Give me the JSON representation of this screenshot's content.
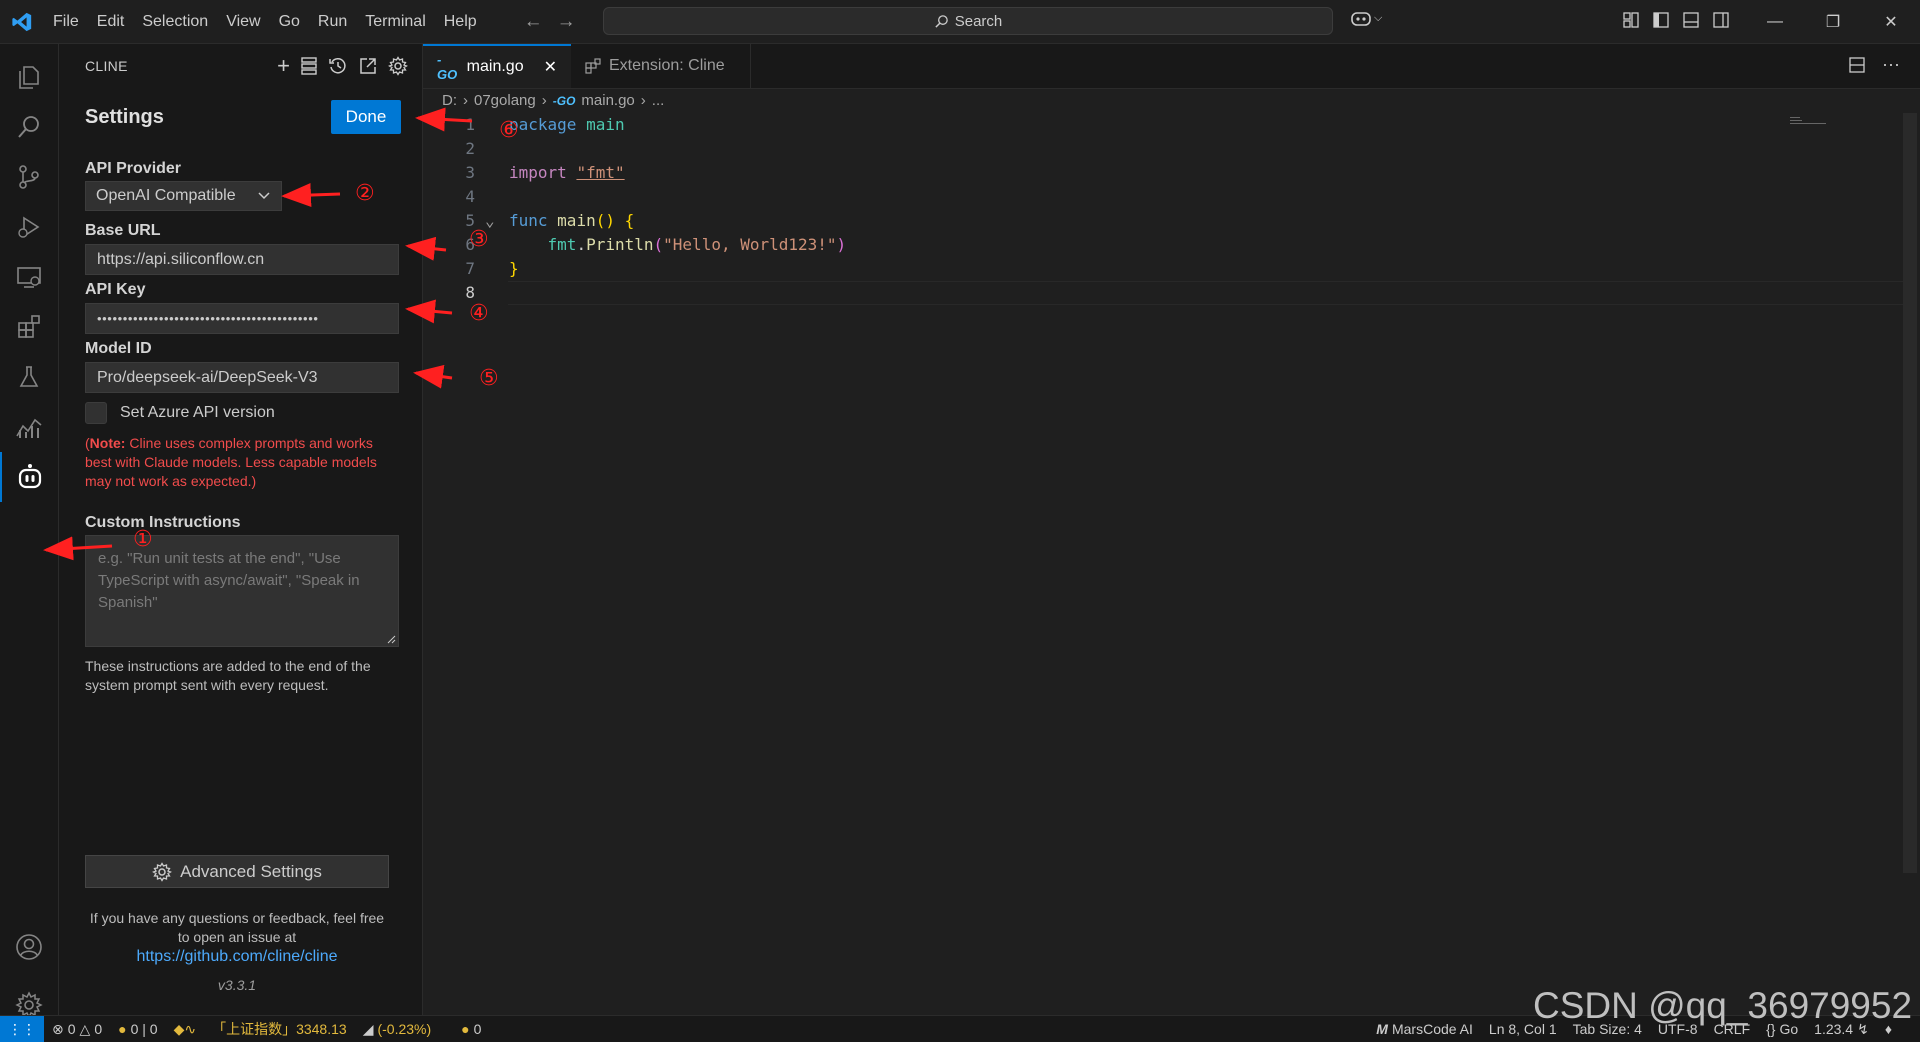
{
  "menu": [
    "File",
    "Edit",
    "Selection",
    "View",
    "Go",
    "Run",
    "Terminal",
    "Help"
  ],
  "search": {
    "label": "Search"
  },
  "sidebar": {
    "title": "CLINE",
    "settings_title": "Settings",
    "done_label": "Done",
    "api_provider_label": "API Provider",
    "api_provider_value": "OpenAI Compatible",
    "base_url_label": "Base URL",
    "base_url_value": "https://api.siliconflow.cn",
    "api_key_label": "API Key",
    "api_key_value": "•••••••••••••••••••••••••••••••••••••••••••",
    "model_id_label": "Model ID",
    "model_id_value": "Pro/deepseek-ai/DeepSeek-V3",
    "azure_label": "Set Azure API version",
    "note_bold": "Note:",
    "note_open": "(",
    "note_text": " Cline uses complex prompts and works best with Claude models. Less capable models may not work as expected.)",
    "custom_instructions_label": "Custom Instructions",
    "custom_instructions_placeholder": "e.g. \"Run unit tests at the end\", \"Use TypeScript with async/await\", \"Speak in Spanish\"",
    "custom_instructions_help": "These instructions are added to the end of the system prompt sent with every request.",
    "advanced_label": "Advanced Settings",
    "feedback_text": "If you have any questions or feedback, feel free to open an issue at",
    "feedback_link": "https://github.com/cline/cline",
    "version": "v3.3.1"
  },
  "tabs": [
    {
      "label": "main.go",
      "active": true
    },
    {
      "label": "Extension: Cline",
      "active": false
    }
  ],
  "breadcrumb": {
    "drive": "D:",
    "folder": "07golang",
    "file": "main.go",
    "more": "..."
  },
  "code": {
    "line_numbers": [
      "1",
      "2",
      "3",
      "4",
      "5",
      "6",
      "7",
      "8"
    ],
    "kw_package": "package",
    "pkg_name": "main",
    "kw_import": "import",
    "import_path": "\"fmt\"",
    "kw_func": "func",
    "fn_main": "main",
    "parens": "()",
    "brace_open": "{",
    "pkg_fmt": "fmt",
    "dot": ".",
    "fn_println": "Println",
    "paren_open": "(",
    "str_hello": "\"Hello, World123!\"",
    "paren_close": ")",
    "brace_close": "}"
  },
  "status": {
    "errors": "0",
    "warnings": "0",
    "ports": "0 | 0",
    "stock_name": "「上证指数」3348.13",
    "stock_change": "(-0.23%)",
    "coins": "0",
    "marscode": "MarsCode AI",
    "position": "Ln 8, Col 1",
    "tab_size": "Tab Size: 4",
    "encoding": "UTF-8",
    "eol": "CRLF",
    "language": "Go",
    "go_version": "1.23.4"
  },
  "annotations": [
    "①",
    "②",
    "③",
    "④",
    "⑤",
    "⑥"
  ],
  "watermark": "CSDN @qq_36979952",
  "colors": {
    "accent": "#0078d4",
    "note_red": "#f14c4c",
    "arrow_red": "#ff2020"
  }
}
